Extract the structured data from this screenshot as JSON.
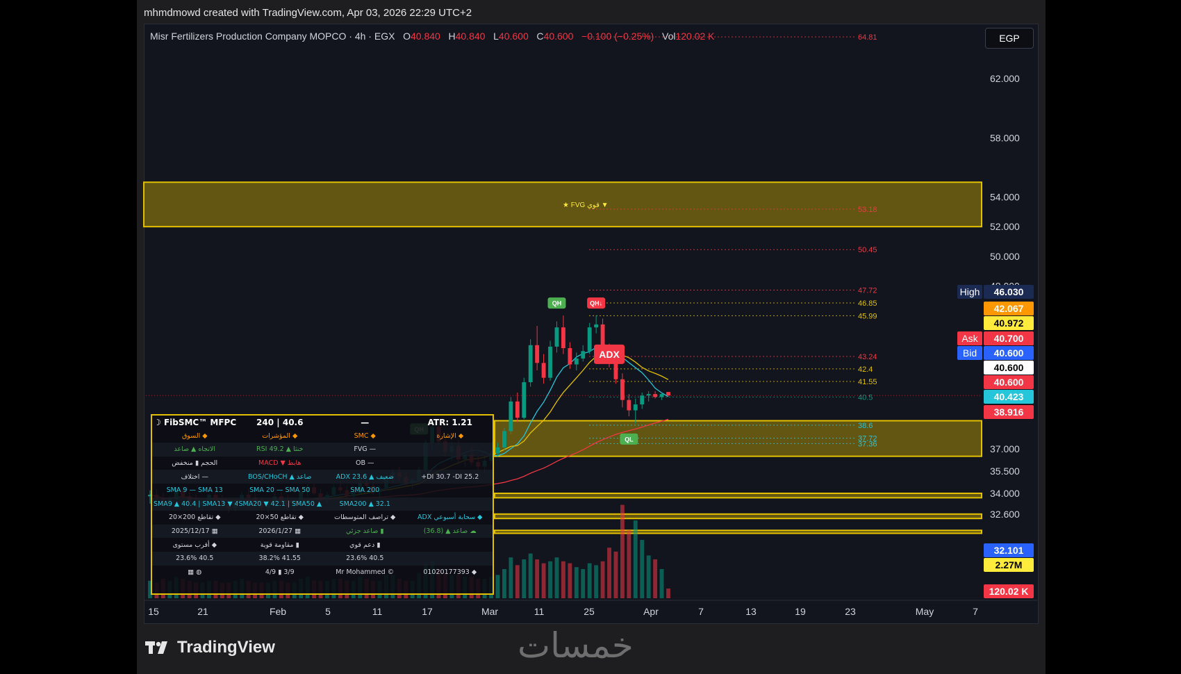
{
  "credit": "mhmdmowd created with TradingView.com, Apr 03, 2026 22:29 UTC+2",
  "header": {
    "symbol": "Misr Fertilizers Production Company MOPCO · 4h · EGX",
    "o_label": "O",
    "o_value": "40.840",
    "h_label": "H",
    "h_value": "40.840",
    "l_label": "L",
    "l_value": "40.600",
    "c_label": "C",
    "c_value": "40.600",
    "change": "−0.100 (−0.25%)",
    "vol_label": "Vol",
    "vol_value": "120.02 K"
  },
  "currency": "EGP",
  "brand": "TradingView",
  "watermark": "خمسات",
  "colors": {
    "up": "#089981",
    "down": "#f23645",
    "zone": "#e4c100",
    "bg": "#12151d",
    "cyan": "#26c6da",
    "orange": "#ff9800"
  },
  "chart_data": {
    "type": "candlestick",
    "timeframe": "4h",
    "x_ticks": [
      "15",
      "21",
      "Feb",
      "5",
      "11",
      "17",
      "Mar",
      "11",
      "25",
      "Apr",
      "7",
      "13",
      "19",
      "23",
      "May",
      "7"
    ],
    "y_ticks": [
      "62.000",
      "58.000",
      "54.000",
      "52.000",
      "50.000",
      "48.000",
      "37.000",
      "35.500",
      "34.000",
      "32.600"
    ],
    "ylim": [
      31.0,
      66.0
    ],
    "grid": false,
    "candles": [
      {
        "x": 0,
        "o": 33.8,
        "h": 34.2,
        "l": 33.3,
        "c": 33.9,
        "v": 0.9
      },
      {
        "x": 1,
        "o": 33.9,
        "h": 34.3,
        "l": 33.5,
        "c": 33.7,
        "v": 0.8
      },
      {
        "x": 2,
        "o": 33.7,
        "h": 34.0,
        "l": 33.2,
        "c": 33.4,
        "v": 1.0
      },
      {
        "x": 3,
        "o": 33.4,
        "h": 33.8,
        "l": 33.0,
        "c": 33.6,
        "v": 0.9
      },
      {
        "x": 4,
        "o": 33.6,
        "h": 34.4,
        "l": 33.4,
        "c": 34.2,
        "v": 1.1
      },
      {
        "x": 5,
        "o": 34.2,
        "h": 34.5,
        "l": 33.6,
        "c": 33.8,
        "v": 1.0
      },
      {
        "x": 6,
        "o": 33.8,
        "h": 34.1,
        "l": 33.2,
        "c": 33.4,
        "v": 0.9
      },
      {
        "x": 7,
        "o": 33.4,
        "h": 33.9,
        "l": 32.9,
        "c": 33.1,
        "v": 0.8
      },
      {
        "x": 8,
        "o": 33.1,
        "h": 33.7,
        "l": 32.8,
        "c": 33.5,
        "v": 0.8
      },
      {
        "x": 9,
        "o": 33.5,
        "h": 34.0,
        "l": 33.2,
        "c": 33.9,
        "v": 0.9
      },
      {
        "x": 10,
        "o": 33.9,
        "h": 34.2,
        "l": 33.3,
        "c": 33.5,
        "v": 0.9
      },
      {
        "x": 11,
        "o": 33.5,
        "h": 33.9,
        "l": 33.0,
        "c": 33.2,
        "v": 0.8
      },
      {
        "x": 12,
        "o": 33.2,
        "h": 33.6,
        "l": 32.7,
        "c": 33.0,
        "v": 0.8
      },
      {
        "x": 13,
        "o": 33.0,
        "h": 33.6,
        "l": 32.8,
        "c": 33.4,
        "v": 0.9
      },
      {
        "x": 14,
        "o": 33.4,
        "h": 34.1,
        "l": 33.2,
        "c": 33.9,
        "v": 1.0
      },
      {
        "x": 15,
        "o": 33.9,
        "h": 34.3,
        "l": 33.5,
        "c": 33.7,
        "v": 0.9
      },
      {
        "x": 16,
        "o": 33.7,
        "h": 34.0,
        "l": 33.1,
        "c": 33.3,
        "v": 0.8
      },
      {
        "x": 17,
        "o": 33.3,
        "h": 33.7,
        "l": 32.8,
        "c": 33.0,
        "v": 0.8
      },
      {
        "x": 18,
        "o": 33.0,
        "h": 33.5,
        "l": 32.7,
        "c": 33.3,
        "v": 0.8
      },
      {
        "x": 19,
        "o": 33.3,
        "h": 34.0,
        "l": 33.1,
        "c": 33.8,
        "v": 0.9
      },
      {
        "x": 20,
        "o": 33.8,
        "h": 34.2,
        "l": 33.3,
        "c": 33.5,
        "v": 0.9
      },
      {
        "x": 21,
        "o": 33.5,
        "h": 33.9,
        "l": 32.9,
        "c": 33.1,
        "v": 0.8
      },
      {
        "x": 22,
        "o": 33.1,
        "h": 33.6,
        "l": 32.8,
        "c": 33.4,
        "v": 0.8
      },
      {
        "x": 23,
        "o": 33.4,
        "h": 34.3,
        "l": 33.3,
        "c": 34.1,
        "v": 1.0
      },
      {
        "x": 24,
        "o": 34.1,
        "h": 34.6,
        "l": 33.8,
        "c": 34.4,
        "v": 1.1
      },
      {
        "x": 25,
        "o": 34.4,
        "h": 34.7,
        "l": 33.9,
        "c": 34.0,
        "v": 0.9
      },
      {
        "x": 26,
        "o": 34.0,
        "h": 34.3,
        "l": 33.4,
        "c": 33.6,
        "v": 0.9
      },
      {
        "x": 27,
        "o": 33.6,
        "h": 34.1,
        "l": 33.3,
        "c": 33.9,
        "v": 0.9
      },
      {
        "x": 28,
        "o": 33.9,
        "h": 34.6,
        "l": 33.7,
        "c": 34.4,
        "v": 1.0
      },
      {
        "x": 29,
        "o": 34.4,
        "h": 34.8,
        "l": 34.0,
        "c": 34.2,
        "v": 1.0
      },
      {
        "x": 30,
        "o": 34.2,
        "h": 34.5,
        "l": 33.6,
        "c": 33.8,
        "v": 0.9
      },
      {
        "x": 31,
        "o": 33.8,
        "h": 34.2,
        "l": 33.4,
        "c": 34.0,
        "v": 0.9
      },
      {
        "x": 32,
        "o": 34.0,
        "h": 34.9,
        "l": 33.9,
        "c": 34.7,
        "v": 1.1
      },
      {
        "x": 33,
        "o": 34.7,
        "h": 35.1,
        "l": 34.3,
        "c": 34.5,
        "v": 1.0
      },
      {
        "x": 34,
        "o": 34.5,
        "h": 34.8,
        "l": 33.9,
        "c": 34.1,
        "v": 0.9
      },
      {
        "x": 35,
        "o": 34.1,
        "h": 34.5,
        "l": 33.7,
        "c": 34.3,
        "v": 0.9
      },
      {
        "x": 36,
        "o": 34.3,
        "h": 35.2,
        "l": 34.2,
        "c": 35.0,
        "v": 1.2
      },
      {
        "x": 37,
        "o": 35.0,
        "h": 35.6,
        "l": 34.7,
        "c": 35.4,
        "v": 1.2
      },
      {
        "x": 38,
        "o": 35.4,
        "h": 35.8,
        "l": 34.9,
        "c": 35.1,
        "v": 1.0
      },
      {
        "x": 39,
        "o": 35.1,
        "h": 35.4,
        "l": 34.5,
        "c": 34.7,
        "v": 0.9
      },
      {
        "x": 40,
        "o": 34.7,
        "h": 35.1,
        "l": 34.3,
        "c": 34.9,
        "v": 0.9
      },
      {
        "x": 41,
        "o": 34.9,
        "h": 35.8,
        "l": 34.8,
        "c": 35.6,
        "v": 1.3
      },
      {
        "x": 42,
        "o": 35.6,
        "h": 37.6,
        "l": 35.4,
        "c": 37.4,
        "v": 1.8
      },
      {
        "x": 43,
        "o": 37.4,
        "h": 38.8,
        "l": 37.0,
        "c": 38.5,
        "v": 1.9
      },
      {
        "x": 44,
        "o": 38.5,
        "h": 38.9,
        "l": 37.2,
        "c": 37.5,
        "v": 1.5
      },
      {
        "x": 45,
        "o": 37.5,
        "h": 37.9,
        "l": 36.5,
        "c": 36.8,
        "v": 1.3
      },
      {
        "x": 46,
        "o": 36.8,
        "h": 37.5,
        "l": 36.2,
        "c": 37.2,
        "v": 1.2
      },
      {
        "x": 47,
        "o": 37.2,
        "h": 37.6,
        "l": 36.1,
        "c": 36.3,
        "v": 1.2
      },
      {
        "x": 48,
        "o": 36.3,
        "h": 36.8,
        "l": 35.8,
        "c": 36.6,
        "v": 1.1
      },
      {
        "x": 49,
        "o": 36.6,
        "h": 37.2,
        "l": 35.9,
        "c": 36.1,
        "v": 1.1
      },
      {
        "x": 50,
        "o": 36.1,
        "h": 36.5,
        "l": 35.5,
        "c": 35.8,
        "v": 1.0
      },
      {
        "x": 51,
        "o": 35.8,
        "h": 36.4,
        "l": 35.4,
        "c": 36.2,
        "v": 1.0
      },
      {
        "x": 52,
        "o": 36.2,
        "h": 36.9,
        "l": 36.0,
        "c": 36.7,
        "v": 1.1
      },
      {
        "x": 53,
        "o": 36.7,
        "h": 37.4,
        "l": 36.5,
        "c": 37.1,
        "v": 1.2
      },
      {
        "x": 54,
        "o": 37.1,
        "h": 38.4,
        "l": 36.9,
        "c": 38.2,
        "v": 1.5
      },
      {
        "x": 55,
        "o": 38.2,
        "h": 40.5,
        "l": 38.0,
        "c": 40.2,
        "v": 2.1
      },
      {
        "x": 56,
        "o": 40.2,
        "h": 40.8,
        "l": 38.8,
        "c": 39.1,
        "v": 1.7
      },
      {
        "x": 57,
        "o": 39.1,
        "h": 41.8,
        "l": 39.0,
        "c": 41.5,
        "v": 2.0
      },
      {
        "x": 58,
        "o": 41.5,
        "h": 44.4,
        "l": 41.2,
        "c": 44.0,
        "v": 2.3
      },
      {
        "x": 59,
        "o": 44.0,
        "h": 45.3,
        "l": 42.3,
        "c": 42.8,
        "v": 2.0
      },
      {
        "x": 60,
        "o": 42.8,
        "h": 43.4,
        "l": 41.4,
        "c": 41.8,
        "v": 1.8
      },
      {
        "x": 61,
        "o": 41.8,
        "h": 44.3,
        "l": 41.6,
        "c": 43.9,
        "v": 1.9
      },
      {
        "x": 62,
        "o": 43.9,
        "h": 45.6,
        "l": 43.5,
        "c": 45.2,
        "v": 2.1
      },
      {
        "x": 63,
        "o": 45.2,
        "h": 46.0,
        "l": 43.4,
        "c": 43.8,
        "v": 1.9
      },
      {
        "x": 64,
        "o": 43.8,
        "h": 44.2,
        "l": 42.4,
        "c": 42.7,
        "v": 1.8
      },
      {
        "x": 65,
        "o": 42.7,
        "h": 43.5,
        "l": 42.3,
        "c": 43.1,
        "v": 1.6
      },
      {
        "x": 66,
        "o": 43.1,
        "h": 44.0,
        "l": 42.9,
        "c": 43.6,
        "v": 1.5
      },
      {
        "x": 67,
        "o": 43.6,
        "h": 45.5,
        "l": 43.4,
        "c": 45.2,
        "v": 1.8
      },
      {
        "x": 68,
        "o": 45.2,
        "h": 46.0,
        "l": 44.8,
        "c": 45.4,
        "v": 1.7
      },
      {
        "x": 69,
        "o": 45.4,
        "h": 45.8,
        "l": 43.3,
        "c": 43.6,
        "v": 1.9
      },
      {
        "x": 70,
        "o": 43.6,
        "h": 44.1,
        "l": 42.5,
        "c": 42.9,
        "v": 2.6
      },
      {
        "x": 71,
        "o": 42.9,
        "h": 43.4,
        "l": 41.4,
        "c": 41.7,
        "v": 2.4
      },
      {
        "x": 72,
        "o": 41.7,
        "h": 42.1,
        "l": 39.8,
        "c": 40.3,
        "v": 4.8
      },
      {
        "x": 73,
        "o": 40.3,
        "h": 40.7,
        "l": 39.2,
        "c": 39.6,
        "v": 3.5
      },
      {
        "x": 74,
        "o": 39.6,
        "h": 40.4,
        "l": 38.7,
        "c": 40.0,
        "v": 4.0
      },
      {
        "x": 75,
        "o": 40.0,
        "h": 40.8,
        "l": 39.7,
        "c": 40.6,
        "v": 3.0
      },
      {
        "x": 76,
        "o": 40.6,
        "h": 40.9,
        "l": 40.2,
        "c": 40.7,
        "v": 2.2
      },
      {
        "x": 77,
        "o": 40.7,
        "h": 40.9,
        "l": 40.4,
        "c": 40.5,
        "v": 2.0
      },
      {
        "x": 78,
        "o": 40.5,
        "h": 40.8,
        "l": 40.3,
        "c": 40.7,
        "v": 1.5
      },
      {
        "x": 79,
        "o": 40.84,
        "h": 40.84,
        "l": 40.6,
        "c": 40.6,
        "v": 0.5
      }
    ],
    "moving_averages": [
      {
        "name": "SMA 9",
        "color": "#26c6da"
      },
      {
        "name": "SMA 13",
        "color": "#e4c100"
      },
      {
        "name": "SMA 50",
        "color": "#f23645"
      }
    ],
    "levels": [
      {
        "price": 64.81,
        "label": "64.81",
        "color": "#f23645"
      },
      {
        "price": 53.18,
        "label": "53.18",
        "color": "#f23645"
      },
      {
        "price": 50.45,
        "label": "50.45",
        "color": "#f23645"
      },
      {
        "price": 47.72,
        "label": "47.72",
        "color": "#f23645"
      },
      {
        "price": 46.85,
        "label": "46.85",
        "color": "#e4c100"
      },
      {
        "price": 45.99,
        "label": "45.99",
        "color": "#e4c100"
      },
      {
        "price": 43.24,
        "label": "43.24",
        "color": "#f23645"
      },
      {
        "price": 42.4,
        "label": "42.4",
        "color": "#e4c100"
      },
      {
        "price": 41.55,
        "label": "41.55",
        "color": "#e4c100"
      },
      {
        "price": 40.5,
        "label": "40.5",
        "color": "#089981"
      },
      {
        "price": 38.6,
        "label": "38.6",
        "color": "#26c6da"
      },
      {
        "price": 37.72,
        "label": "37.72",
        "color": "#26c6da"
      },
      {
        "price": 37.36,
        "label": "37.36",
        "color": "#26c6da"
      }
    ],
    "zones": [
      {
        "top": 55.0,
        "bottom": 52.0,
        "label": "FVG قوي ▼"
      },
      {
        "top": 38.9,
        "bottom": 36.5,
        "label": ""
      },
      {
        "top": 34.0,
        "bottom": 33.7,
        "label": ""
      },
      {
        "top": 32.6,
        "bottom": 32.3,
        "label": ""
      },
      {
        "top": 31.5,
        "bottom": 31.3,
        "label": ""
      }
    ],
    "price_tags": [
      {
        "label": "High",
        "value": "46.030",
        "color": "#1a2a52"
      },
      {
        "label": "",
        "value": "42.067",
        "color": "#ff9800"
      },
      {
        "label": "",
        "value": "40.972",
        "color": "#ffeb3b"
      },
      {
        "label": "Ask",
        "value": "40.700",
        "color": "#f23645"
      },
      {
        "label": "Bid",
        "value": "40.600",
        "color": "#2962ff"
      },
      {
        "label": "",
        "value": "40.600",
        "color": "#ffffff"
      },
      {
        "label": "",
        "value": "40.600",
        "color": "#f23645"
      },
      {
        "label": "",
        "value": "40.423",
        "color": "#26c6da"
      },
      {
        "label": "",
        "value": "38.916",
        "color": "#f23645"
      },
      {
        "label": "",
        "value": "32.101",
        "color": "#2962ff"
      },
      {
        "label": "",
        "value": "2.27M",
        "color": "#ffeb3b"
      },
      {
        "label": "",
        "value": "120.02 K",
        "color": "#f23645"
      }
    ],
    "markers": [
      {
        "text": "QH",
        "color": "#4caf50"
      },
      {
        "text": "QH↓",
        "color": "#f23645"
      },
      {
        "text": "QL",
        "color": "#4caf50"
      },
      {
        "text": "QH",
        "color": "#4caf50"
      },
      {
        "text": "ADX",
        "color": "#f23645"
      }
    ]
  },
  "panel": {
    "title": "FibSMC™ MFPC",
    "tf": "240",
    "sep": "|",
    "price": "40.6",
    "dash": "—",
    "atr": "ATR: 1.21",
    "rows": [
      [
        "السوق ◆",
        "المؤشرات ◆",
        "SMC ◆",
        "الإشارة ◆"
      ],
      [
        "الاتجاه ▲ صاعد",
        "RSI 49.2 ▲ خنثا",
        "FVG —",
        ""
      ],
      [
        "الحجم ▮ منخفض",
        "MACD ▼ هابط",
        "OB —",
        ""
      ],
      [
        "اختلاف —",
        "BOS/CHoCH ▲ صاعد",
        "ADX 23.6 ▲ ضعيف",
        "+DI 30.7  -DI 25.2"
      ],
      [
        "SMA 9 — SMA 13",
        "SMA 20 — SMA 50",
        "SMA 200",
        ""
      ],
      [
        "SMA9 ▲ 40.4 | SMA13 ▼ 41",
        "SMA20 ▼ 42.1 | SMA50 ▲ 38.9",
        "SMA200 ▲ 32.1",
        ""
      ],
      [
        "تقاطع 200×20 ◆",
        "تقاطع 50×20 ◆",
        "تراصف المتوسطات ◆",
        "ADX سحابة أسبوعي ◆"
      ],
      [
        "2025/12/17 ▦",
        "2026/1/27 ▦",
        "صاعد جزئي ▮",
        "(36.8) ▲ صاعد ☁"
      ],
      [
        "أقرب مستوى ◆",
        "مقاومة قوية ▮",
        "دعم قوي ▮",
        ""
      ],
      [
        "23.6% 40.5",
        "38.2% 41.55",
        "23.6% 40.5",
        ""
      ],
      [
        "▦ ◍",
        "4/9 ▮ 3/9",
        "Mr Mohammed ©",
        "01020177393 ◆"
      ]
    ]
  }
}
